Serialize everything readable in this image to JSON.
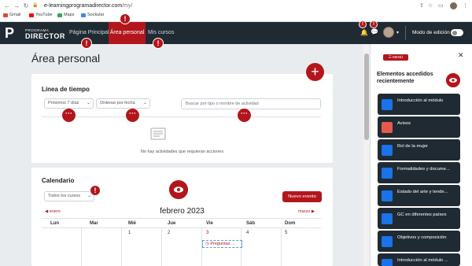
{
  "browser": {
    "url_host": "e-learningprogramadirector.com",
    "url_path": "/my/",
    "bookmarks": [
      "Gmail",
      "YouTube",
      "Maps",
      "Sockular"
    ]
  },
  "navbar": {
    "logo_mark": "P",
    "logo_small": "PROGRAMA",
    "logo_big": "DIRECTOR",
    "links": [
      "Página Principal",
      "Área personal",
      "Mis cursos"
    ],
    "edit_mode_label": "Modo de edición"
  },
  "main": {
    "title": "Área personal",
    "timeline": {
      "heading": "Línea de tiempo",
      "filter_range": "Próximos 7 días",
      "sort": "Ordenar por fecha",
      "search_placeholder": "Buscar por tipo o nombre de actividad",
      "empty_text": "No hay actividades que requieran acciones"
    },
    "calendar": {
      "heading": "Calendario",
      "course_filter": "Todos los cursos",
      "new_event": "Nuevo evento",
      "month": "febrero 2023",
      "prev": "enero",
      "next": "marzo",
      "days": [
        "Lun",
        "Mar",
        "Mié",
        "Jue",
        "Vie",
        "Sáb",
        "Dom"
      ],
      "first_row": [
        "",
        "",
        "1",
        "2",
        "3",
        "4",
        "5"
      ],
      "event": "Preguntas ..."
    }
  },
  "drawer": {
    "menu_label": "MENÚ",
    "title": "Elementos accedidos recientemente",
    "items": [
      "Introducción al módulo",
      "Avisos",
      "Rol de la mujer",
      "Formalidades y docume...",
      "Estado del arte y tende...",
      "GC en diferentes países",
      "Objetivos y composición",
      "Introducción al módulo ..."
    ]
  },
  "alerts": {
    "symbol": "!"
  },
  "colors": {
    "accent": "#b2161c",
    "navbar": "#1f2a33",
    "drawer_item": "#1f2a33"
  }
}
